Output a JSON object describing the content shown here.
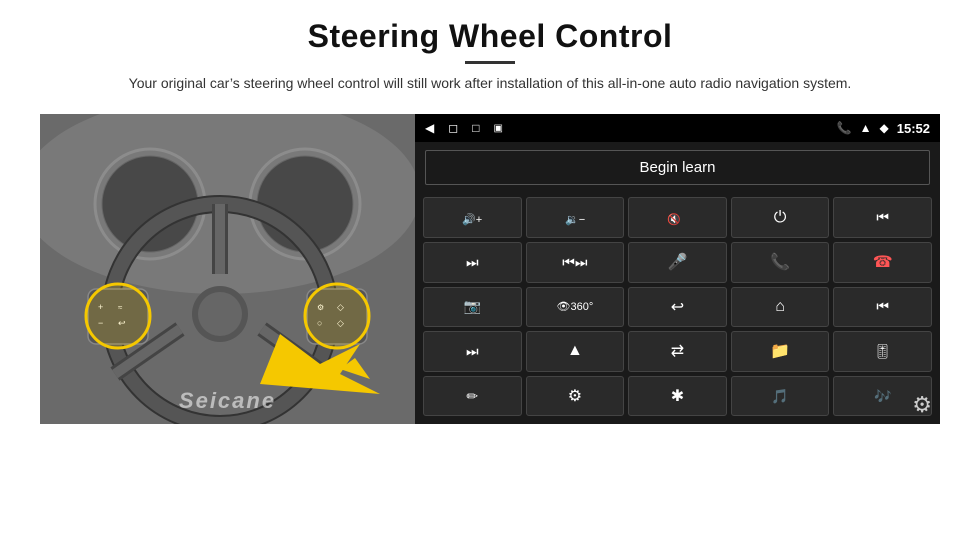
{
  "header": {
    "title": "Steering Wheel Control",
    "subtitle": "Your original car’s steering wheel control will still work after installation of this all-in-one auto radio navigation system."
  },
  "status_bar": {
    "time": "15:52",
    "icons_left": [
      "back-arrow",
      "square-rounded",
      "square"
    ],
    "icons_right": [
      "signal",
      "wifi",
      "location",
      "battery"
    ]
  },
  "begin_learn": {
    "label": "Begin learn"
  },
  "controls": [
    {
      "icon": "vol+",
      "symbol": "🔊+"
    },
    {
      "icon": "vol-",
      "symbol": "🔉-"
    },
    {
      "icon": "mute",
      "symbol": "🔇×"
    },
    {
      "icon": "power",
      "symbol": "⏻"
    },
    {
      "icon": "prev-track",
      "symbol": "⏮"
    },
    {
      "icon": "next",
      "symbol": "⏭"
    },
    {
      "icon": "skip-back",
      "symbol": "⏮⏭"
    },
    {
      "icon": "mic",
      "symbol": "🎤"
    },
    {
      "icon": "phone",
      "symbol": "📞"
    },
    {
      "icon": "hang-up",
      "symbol": "📵"
    },
    {
      "icon": "camera",
      "symbol": "📷"
    },
    {
      "icon": "360",
      "symbol": "👁360"
    },
    {
      "icon": "back",
      "symbol": "↩"
    },
    {
      "icon": "home",
      "symbol": "🏠"
    },
    {
      "icon": "rewind",
      "symbol": "⏮"
    },
    {
      "icon": "fast-forward",
      "symbol": "⏭"
    },
    {
      "icon": "navigate",
      "symbol": "▲"
    },
    {
      "icon": "switch",
      "symbol": "⇄"
    },
    {
      "icon": "folder",
      "symbol": "📁"
    },
    {
      "icon": "equalizer",
      "symbol": "🎚"
    },
    {
      "icon": "pen",
      "symbol": "✏"
    },
    {
      "icon": "settings-knob",
      "symbol": "⚙"
    },
    {
      "icon": "bluetooth",
      "symbol": "⚡"
    },
    {
      "icon": "music",
      "symbol": "🎵"
    },
    {
      "icon": "audio-bars",
      "symbol": "🎶"
    }
  ],
  "watermark": "Seicane",
  "gear_icon": "⚙"
}
